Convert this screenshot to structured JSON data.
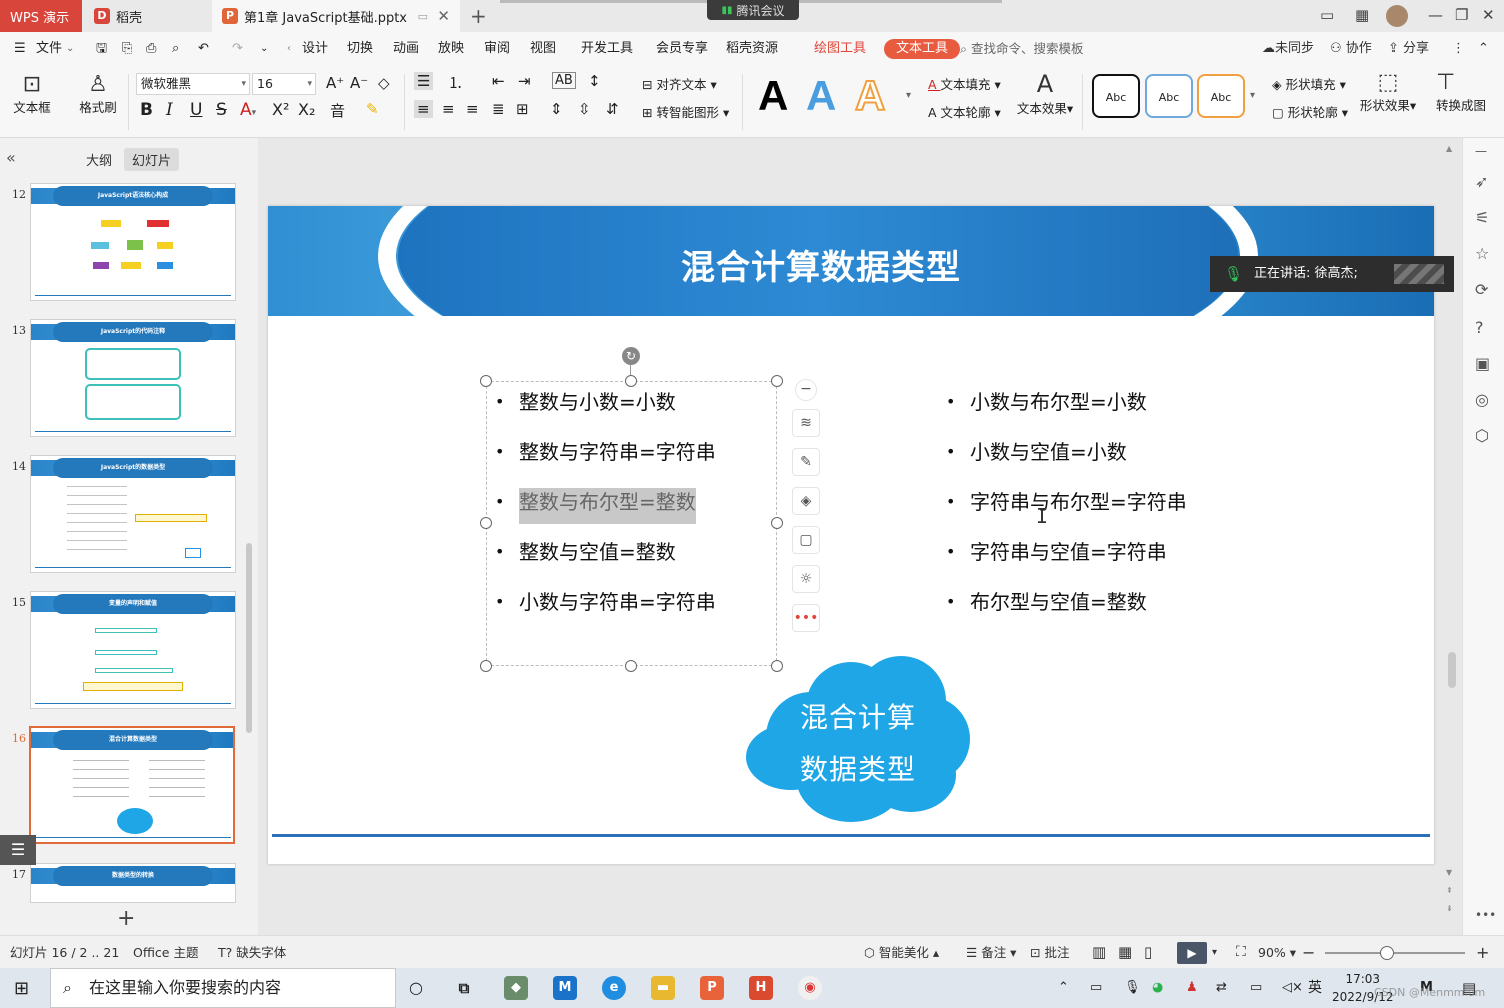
{
  "titlebar": {
    "app_tab": "WPS 演示",
    "daoke_tab": "稻壳",
    "doc_tab": "第1章 JavaScript基础.pptx",
    "meeting": "腾讯会议"
  },
  "menu": {
    "file": "文件",
    "items": [
      "设计",
      "切换",
      "动画",
      "放映",
      "审阅",
      "视图",
      "开发工具",
      "会员专享",
      "稻壳资源"
    ],
    "drawing_tools": "绘图工具",
    "text_tools": "文本工具",
    "search": "查找命令、搜索模板",
    "sync": "未同步",
    "collab": "协作",
    "share": "分享"
  },
  "ribbon": {
    "textbox": "文本框",
    "format_brush": "格式刷",
    "font_name": "微软雅黑",
    "font_size": "16",
    "align_text": "对齐文本",
    "smart_shape": "转智能图形",
    "text_fill": "文本填充",
    "text_outline": "文本轮廓",
    "text_effect": "文本效果",
    "style_a": "A",
    "abc": "Abc",
    "shape_fill": "形状填充",
    "shape_outline": "形状轮廓",
    "shape_effect": "形状效果",
    "convert": "转换成图"
  },
  "left_panel": {
    "outline_tab": "大纲",
    "slides_tab": "幻灯片",
    "thumbnails": [
      {
        "num": "12",
        "title": "JavaScript语法核心构成"
      },
      {
        "num": "13",
        "title": "JavaScript的代码注释"
      },
      {
        "num": "14",
        "title": "JavaScript的数据类型"
      },
      {
        "num": "15",
        "title": "变量的声明和赋值"
      },
      {
        "num": "16",
        "title": "混合计算数据类型"
      },
      {
        "num": "17",
        "title": "数据类型的转换"
      }
    ]
  },
  "slide": {
    "title": "混合计算数据类型",
    "left_bullets": [
      "整数与小数=小数",
      "整数与字符串=字符串",
      "整数与布尔型=整数",
      "整数与空值=整数",
      "小数与字符串=字符串"
    ],
    "right_bullets": [
      "小数与布尔型=小数",
      "小数与空值=小数",
      "字符串与布尔型=字符串",
      "字符串与空值=字符串",
      "布尔型与空值=整数"
    ],
    "cloud_line1": "混合计算",
    "cloud_line2": "数据类型",
    "speaker": "正在讲话: 徐高杰;"
  },
  "status": {
    "slide_info": "幻灯片 16 / 2 .. 21",
    "theme": "Office 主题",
    "missing_font": "缺失字体",
    "beautify": "智能美化",
    "notes": "备注",
    "comments": "批注",
    "zoom": "90%"
  },
  "taskbar": {
    "search_placeholder": "在这里输入你要搜索的内容",
    "ime": "英",
    "time": "17:03",
    "date": "2022/9/12"
  },
  "watermark": "CSDN @Menmmium",
  "colors": {
    "accent": "#e85b3f",
    "slide_blue": "#2479bd",
    "cloud": "#1ea6e6"
  }
}
